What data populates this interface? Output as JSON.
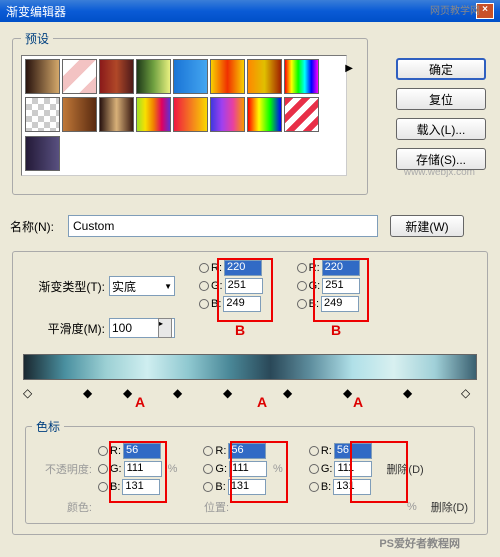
{
  "window": {
    "title": "渐变编辑器"
  },
  "watermarks": {
    "top": "网页教学网",
    "mid": "www.webjx.com",
    "bottom": "PS爱好者教程网"
  },
  "presets": {
    "legend": "预设",
    "swatches": [
      "linear-gradient(to right,#28130e,#d4a86a)",
      "linear-gradient(135deg,#fff 25%,#f3c3c3 25%,#f3c3c3 50%,#fff 50%,#fff 75%,#f3c3c3 75%)",
      "linear-gradient(to right,#8a1a1a,#b04828,#4e1a1a)",
      "linear-gradient(to right,#1f3a1a,#6fa040,#e8f080)",
      "linear-gradient(to right,#1a74d6,#44a6f0)",
      "linear-gradient(to right,#f8d000,#f03000,#f8d000)",
      "linear-gradient(to right,#ff8800,#e0c000,#a02000)",
      "linear-gradient(to right,#f00,#ff0,#0f0,#0ff,#00f,#f0f)",
      "repeating-conic-gradient(#ccc 0 25%,#fff 0 50%) 0 0/12px 12px",
      "linear-gradient(to right,#c07838,#5a2a10)",
      "linear-gradient(to right,#2a1410,#d8b078,#3a1a12)",
      "linear-gradient(to right,#a0e028,#f8e000,#f08000,#e00060,#6030d0)",
      "linear-gradient(to right,#f01840,#f8d800)",
      "linear-gradient(to right,#4038e0,#a040f0,#e840a0,#f89800)",
      "linear-gradient(to right,#f00,#ff0,#0f0,#00f)",
      "repeating-linear-gradient(135deg,#e83048 0 6px,#fff 6px 12px)",
      "linear-gradient(to right,#241a38,#585080)"
    ]
  },
  "buttons": {
    "ok": "确定",
    "reset": "复位",
    "load": "载入(L)...",
    "save": "存储(S)...",
    "new": "新建(W)"
  },
  "name": {
    "label": "名称(N):",
    "value": "Custom"
  },
  "gradient": {
    "type_label": "渐变类型(T):",
    "type_value": "实底",
    "smooth_label": "平滑度(M):",
    "smooth_value": "100",
    "rgbB1": {
      "r": "220",
      "g": "251",
      "b": "249"
    },
    "rgbB2": {
      "r": "220",
      "g": "251",
      "b": "249"
    },
    "letterA": "A",
    "letterB": "B"
  },
  "stops": {
    "legend": "色标",
    "opacity_label": "不透明度:",
    "color_label": "颜色:",
    "position_label": "位置:",
    "delete_label": "删除(D)",
    "percent": "%",
    "A1": {
      "r": "56",
      "g": "111",
      "b": "131"
    },
    "A2": {
      "r": "56",
      "g": "111",
      "b": "131"
    },
    "A3": {
      "r": "56",
      "g": "111",
      "b": "131"
    }
  },
  "rgb_labels": {
    "r": "R:",
    "g": "G:",
    "b": "B:"
  }
}
